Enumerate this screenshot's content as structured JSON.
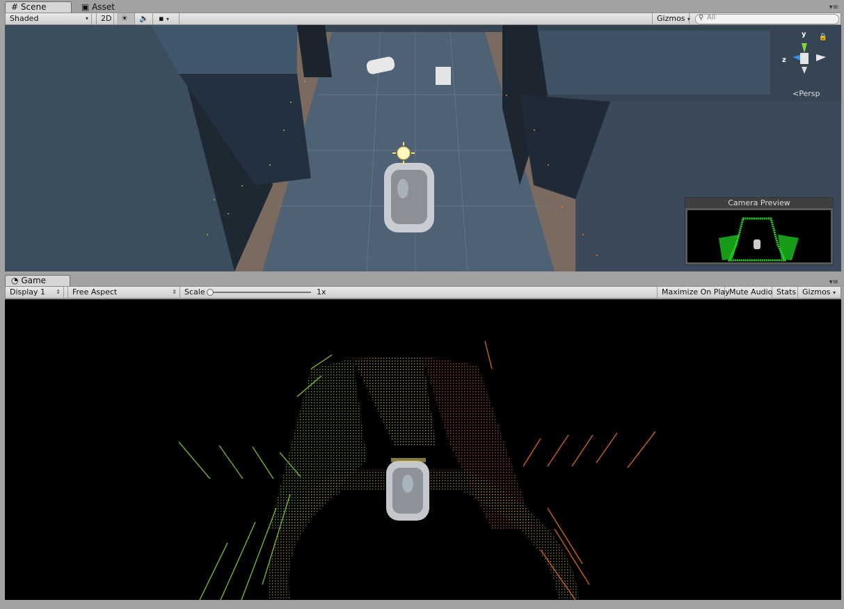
{
  "scene_tabs": [
    {
      "label": "Scene",
      "icon": "grid-icon"
    },
    {
      "label": "Asset Store",
      "icon": "store-icon"
    }
  ],
  "scene_toolbar": {
    "shading_mode": "Shaded",
    "mode_2d": "2D",
    "gizmos": "Gizmos",
    "search_placeholder": "All"
  },
  "gizmo": {
    "y_axis": "y",
    "z_axis": "z",
    "projection": "Persp"
  },
  "camera_preview": {
    "title": "Camera Preview"
  },
  "game_tab": {
    "label": "Game",
    "icon": "pacman-icon"
  },
  "game_toolbar": {
    "display": "Display 1",
    "aspect": "Free Aspect",
    "scale_label": "Scale",
    "scale_value": "1x",
    "maximize_on_play": "Maximize On Play",
    "mute_audio": "Mute Audio",
    "stats": "Stats",
    "gizmos": "Gizmos"
  },
  "colors": {
    "editor_bg": "#a2a2a2",
    "game_bg": "#000000",
    "lidar_left": "#7fbf2a",
    "lidar_right": "#d46a1e",
    "preview_points": "#22dd22"
  }
}
